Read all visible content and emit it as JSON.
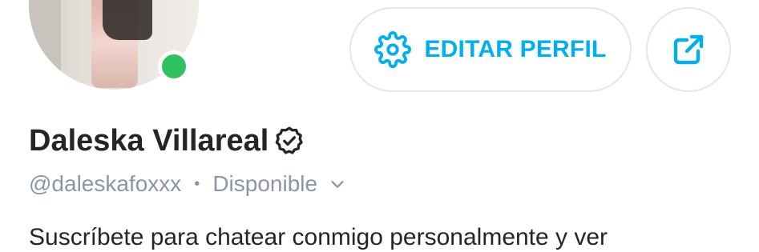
{
  "profile": {
    "display_name": "Daleska Villareal",
    "username": "@daleskafoxxx",
    "separator": "•",
    "status": "Disponible",
    "online": true,
    "verified": true,
    "bio": "Suscríbete para chatear conmigo personalmente y ver"
  },
  "actions": {
    "edit_label": "EDITAR PERFIL",
    "edit_icon": "gear-icon",
    "share_icon": "share-icon"
  },
  "colors": {
    "accent": "#00aff0",
    "online": "#2fc15f",
    "text_primary": "#242529",
    "text_secondary": "#8a96a3",
    "border": "#e4e6ea"
  }
}
